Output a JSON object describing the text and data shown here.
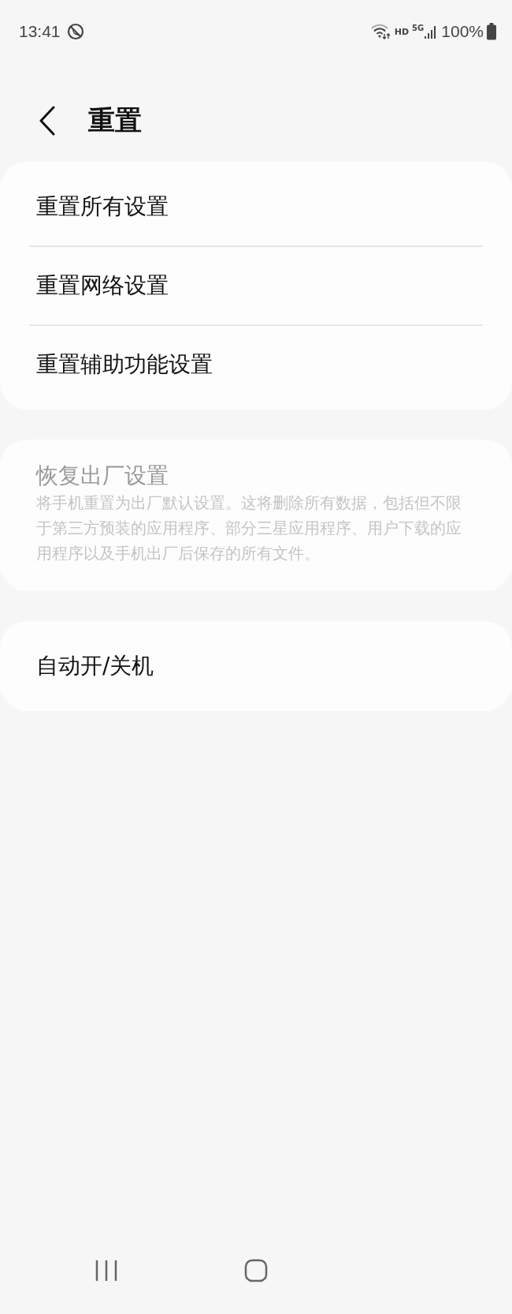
{
  "status_bar": {
    "time": "13:41",
    "network": "HD",
    "signal_label": "5G",
    "battery": "100%"
  },
  "header": {
    "title": "重置"
  },
  "groups": [
    {
      "items": [
        {
          "title": "重置所有设置",
          "disabled": false
        },
        {
          "title": "重置网络设置",
          "disabled": false
        },
        {
          "title": "重置辅助功能设置",
          "disabled": false
        }
      ]
    },
    {
      "items": [
        {
          "title": "恢复出厂设置",
          "description": "将手机重置为出厂默认设置。这将删除所有数据，包括但不限于第三方预装的应用程序、部分三星应用程序、用户下载的应用程序以及手机出厂后保存的所有文件。",
          "disabled": true
        }
      ]
    },
    {
      "items": [
        {
          "title": "自动开/关机",
          "disabled": false
        }
      ]
    }
  ]
}
